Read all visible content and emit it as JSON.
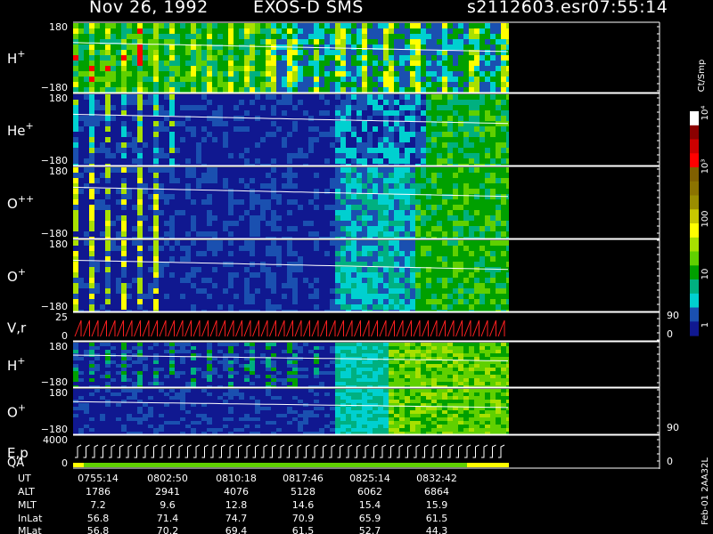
{
  "header": {
    "date": "Nov 26, 1992",
    "instrument": "EXOS-D SMS",
    "file": "s2112603.esr",
    "time": "07:55:14"
  },
  "colorbar": {
    "unit_label": "Ct/Smp",
    "tick_labels": [
      "10⁴",
      "10³",
      "100",
      "10",
      "1"
    ],
    "colors": [
      "#ffffff",
      "#8b0000",
      "#cc0000",
      "#ff0000",
      "#806000",
      "#8b7300",
      "#9a8d00",
      "#c8c800",
      "#ffff00",
      "#a8e000",
      "#60d000",
      "#00a000",
      "#00b080",
      "#00d0d0",
      "#1a50b0",
      "#101890"
    ]
  },
  "right_side_label": "Feb-01 2AA32L",
  "panels": [
    {
      "label": "H",
      "sup": "+",
      "ymax": "180",
      "ymin": "−180"
    },
    {
      "label": "He",
      "sup": "+",
      "ymax": "180",
      "ymin": "−180"
    },
    {
      "label": "O",
      "sup": "++",
      "ymax": "180",
      "ymin": "−180"
    },
    {
      "label": "O",
      "sup": "+",
      "ymax": "180",
      "ymin": "−180"
    },
    {
      "label": "V,r",
      "sup": "",
      "ymax": "25",
      "ymin": "0",
      "right_top": "90",
      "right_bottom": "0"
    },
    {
      "label": "H",
      "sup": "+",
      "ymax": "180",
      "ymin": "−180"
    },
    {
      "label": "O",
      "sup": "+",
      "ymax": "180",
      "ymin": "−180",
      "right_bottom": "90"
    },
    {
      "label": "E,p",
      "label2": "QA",
      "sup": "",
      "ymax": "4000",
      "ymin": "0",
      "right_bottom": "0"
    }
  ],
  "ephemeris": {
    "row_labels": [
      "UT",
      "ALT",
      "MLT",
      "InLat",
      "MLat"
    ],
    "columns": [
      [
        "0755:14",
        "1786",
        "7.2",
        "56.8",
        "56.8"
      ],
      [
        "0802:50",
        "2941",
        "9.6",
        "71.4",
        "70.2"
      ],
      [
        "0810:18",
        "4076",
        "12.8",
        "74.7",
        "69.4"
      ],
      [
        "0817:46",
        "5128",
        "14.6",
        "70.9",
        "61.5"
      ],
      [
        "0825:14",
        "6062",
        "15.4",
        "65.9",
        "52.7"
      ],
      [
        "0832:42",
        "6864",
        "15.9",
        "61.5",
        "44.3"
      ]
    ]
  }
}
